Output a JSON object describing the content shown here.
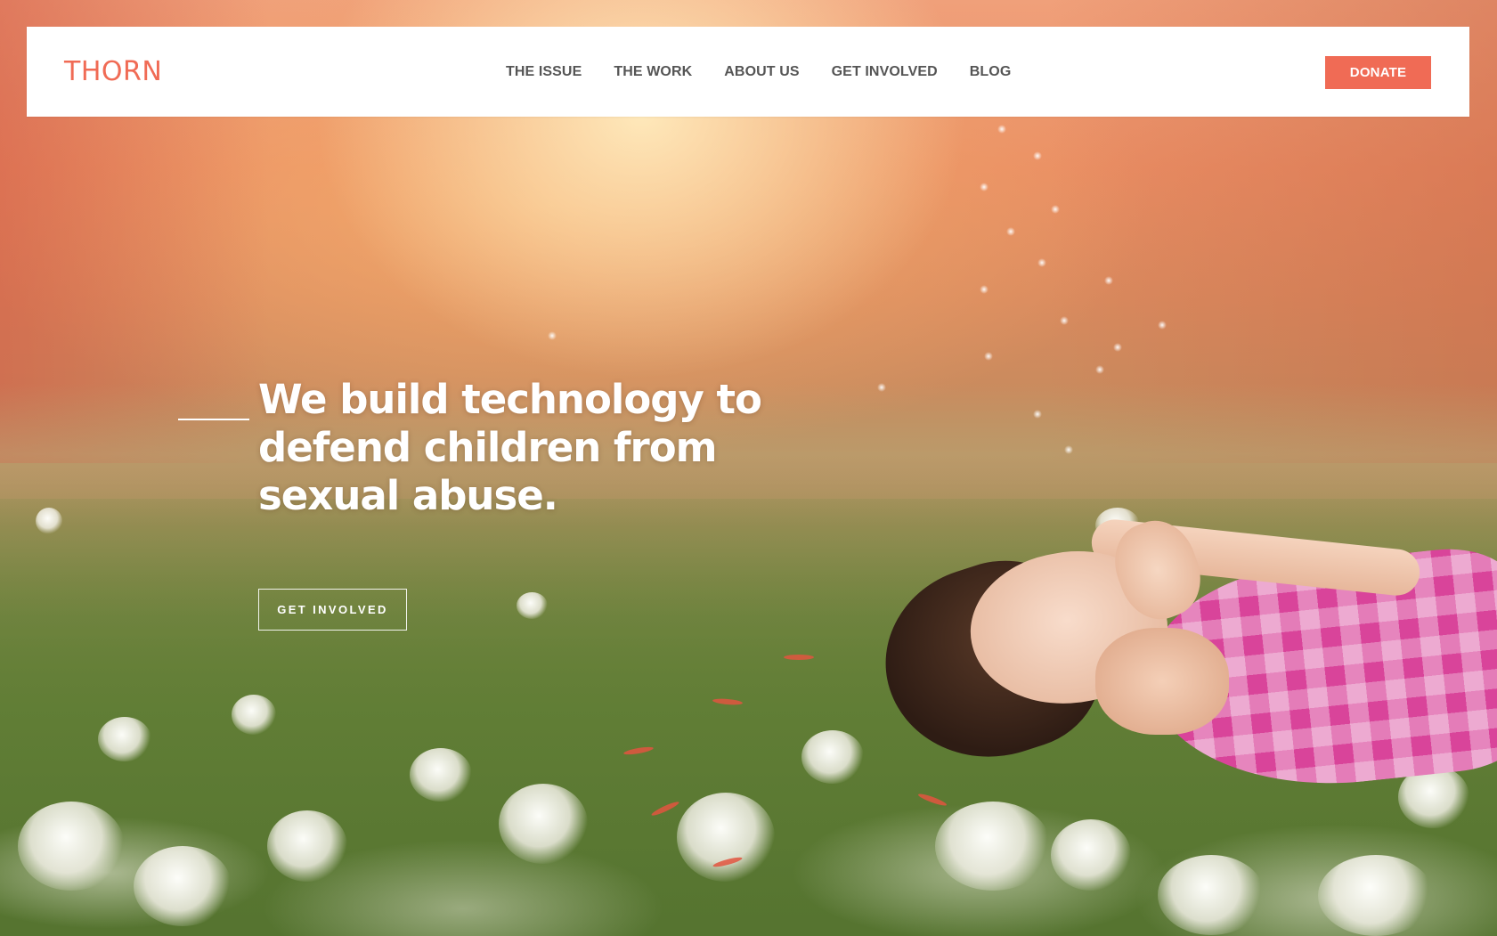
{
  "header": {
    "logo_text": "THORN",
    "nav": [
      {
        "label": "THE ISSUE"
      },
      {
        "label": "THE WORK"
      },
      {
        "label": "ABOUT US"
      },
      {
        "label": "GET INVOLVED"
      },
      {
        "label": "BLOG"
      }
    ],
    "donate_label": "DONATE"
  },
  "hero": {
    "headline": "We build technology to defend children from sexual abuse.",
    "cta_label": "GET INVOLVED",
    "image_subject": "girl lying in a dandelion field blowing seeds"
  },
  "colors": {
    "brand": "#f06b55",
    "nav_text": "#555555",
    "nav_background": "#ffffff",
    "hero_text": "#ffffff"
  }
}
